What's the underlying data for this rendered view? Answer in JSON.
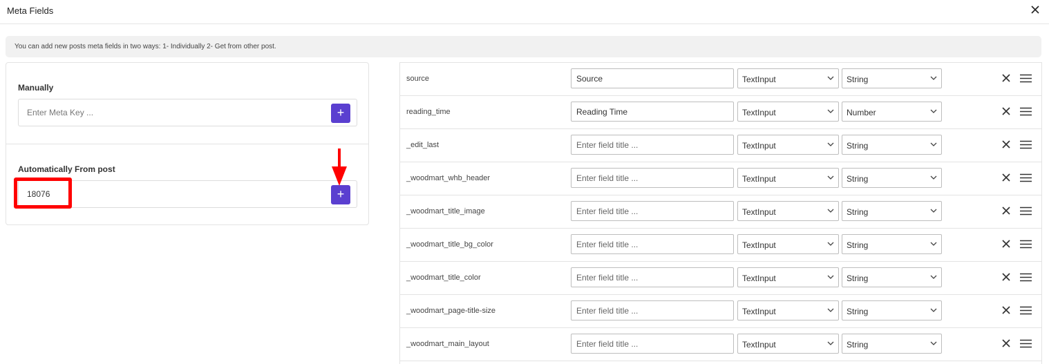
{
  "dialog": {
    "title": "Meta Fields",
    "info_text": "You can add new posts meta fields in two ways: 1- Individually 2- Get from other post."
  },
  "manual": {
    "label": "Manually",
    "placeholder": "Enter Meta Key ...",
    "value": "",
    "add_label": "+"
  },
  "auto": {
    "label": "Automatically From post",
    "placeholder": "",
    "value": "18076",
    "add_label": "+"
  },
  "title_placeholder": "Enter field title ...",
  "colors": {
    "accent": "#5a3fd0",
    "annotation": "#ff0000"
  },
  "rows": [
    {
      "key": "source",
      "title": "Source",
      "field_type": "TextInput",
      "data_type": "String"
    },
    {
      "key": "reading_time",
      "title": "Reading Time",
      "field_type": "TextInput",
      "data_type": "Number"
    },
    {
      "key": "_edit_last",
      "title": "",
      "field_type": "TextInput",
      "data_type": "String"
    },
    {
      "key": "_woodmart_whb_header",
      "title": "",
      "field_type": "TextInput",
      "data_type": "String"
    },
    {
      "key": "_woodmart_title_image",
      "title": "",
      "field_type": "TextInput",
      "data_type": "String"
    },
    {
      "key": "_woodmart_title_bg_color",
      "title": "",
      "field_type": "TextInput",
      "data_type": "String"
    },
    {
      "key": "_woodmart_title_color",
      "title": "",
      "field_type": "TextInput",
      "data_type": "String"
    },
    {
      "key": "_woodmart_page-title-size",
      "title": "",
      "field_type": "TextInput",
      "data_type": "String"
    },
    {
      "key": "_woodmart_main_layout",
      "title": "",
      "field_type": "TextInput",
      "data_type": "String"
    }
  ]
}
